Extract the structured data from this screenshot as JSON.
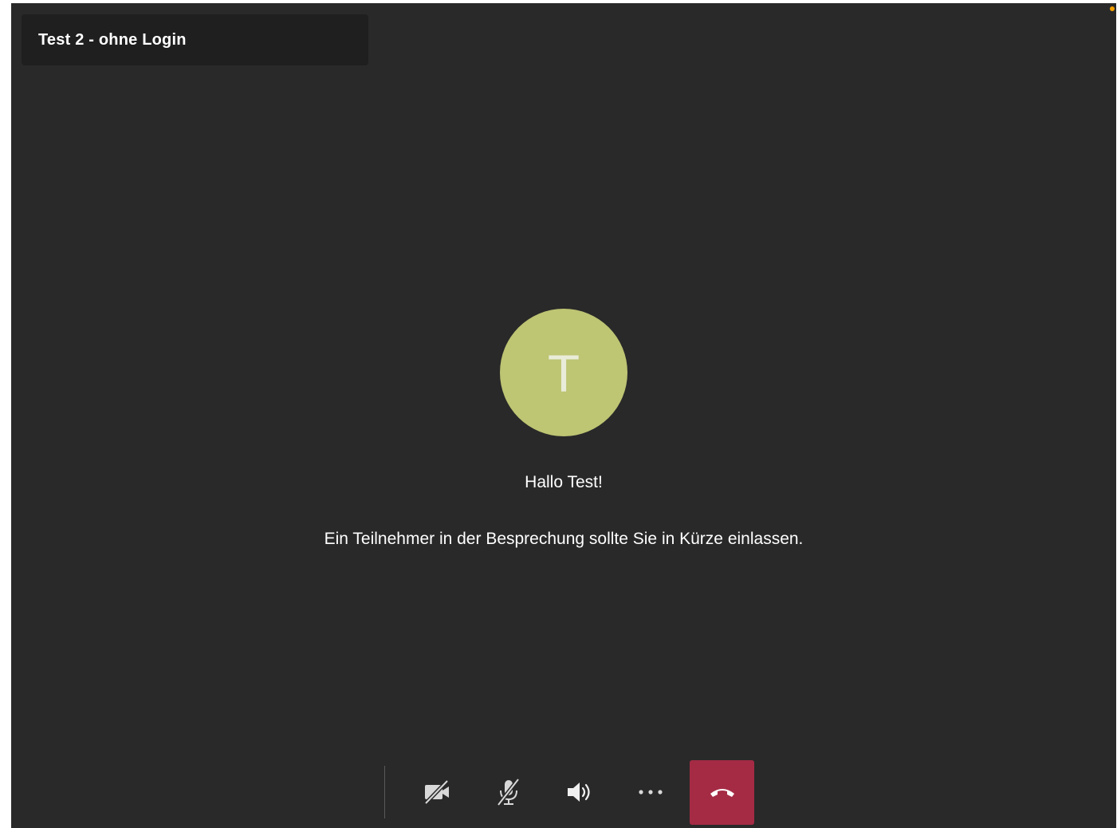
{
  "meeting": {
    "title": "Test 2 - ohne Login"
  },
  "lobby": {
    "avatar_initial": "T",
    "greeting": "Hallo Test!",
    "message": "Ein Teilnehmer in der Besprechung sollte Sie in Kürze einlassen."
  },
  "controls": {
    "camera": {
      "icon": "camera-off-icon",
      "state": "off"
    },
    "microphone": {
      "icon": "microphone-off-icon",
      "state": "off"
    },
    "speaker": {
      "icon": "speaker-icon",
      "state": "on"
    },
    "more": {
      "icon": "more-options-icon"
    },
    "hangup": {
      "icon": "hang-up-icon"
    }
  },
  "colors": {
    "background": "#292929",
    "title_bar": "#1f1f1f",
    "avatar": "#bec573",
    "hangup": "#a52b45",
    "status_dot": "#f5a000"
  }
}
